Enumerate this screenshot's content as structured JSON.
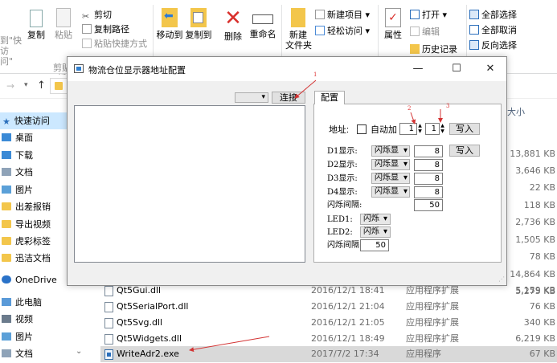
{
  "ribbon": {
    "clipboard_tail": [
      "到\"快",
      "访问\""
    ],
    "copy": "复制",
    "paste": "粘贴",
    "cut": "剪切",
    "copy_path": "复制路径",
    "paste_shortcut": "粘贴快捷方式",
    "group_clipboard": "剪贴板",
    "move_to": "移动到",
    "copy_to": "复制到",
    "delete": "删除",
    "rename": "重命名",
    "new_folder": "新建\n文件夹",
    "new_item": "新建项目",
    "easy_access": "轻松访问",
    "properties": "属性",
    "open": "打开",
    "edit": "编辑",
    "history": "历史记录",
    "select_all": "全部选择",
    "select_none": "全部取消",
    "invert_selection": "反向选择"
  },
  "size_header": "大小",
  "sidebar": {
    "items": [
      {
        "label": "快速访问",
        "icon": "star-icon"
      },
      {
        "label": "桌面",
        "icon": "desktop-folder-icon"
      },
      {
        "label": "下载",
        "icon": "download-folder-icon"
      },
      {
        "label": "文档",
        "icon": "documents-folder-icon"
      },
      {
        "label": "图片",
        "icon": "pictures-folder-icon"
      },
      {
        "label": "出差报销",
        "icon": "folder-icon"
      },
      {
        "label": "导出视频",
        "icon": "folder-icon"
      },
      {
        "label": "虎彩标签",
        "icon": "folder-icon"
      },
      {
        "label": "迅洁文档",
        "icon": "folder-icon"
      },
      {
        "label": "OneDrive",
        "icon": "cloud-icon"
      },
      {
        "label": "此电脑",
        "icon": "computer-icon"
      },
      {
        "label": "视频",
        "icon": "videos-folder-icon"
      },
      {
        "label": "图片",
        "icon": "pictures-folder-icon"
      },
      {
        "label": "文档",
        "icon": "documents-folder-icon"
      }
    ]
  },
  "hidden_sizes": [
    "13,881 KB",
    "3,646 KB",
    "22 KB",
    "118 KB",
    "2,736 KB",
    "1,505 KB",
    "78 KB",
    "14,864 KB",
    "5,275 KB"
  ],
  "files": [
    {
      "name": "Qt5Gui.dll",
      "date": "2016/12/1 18:41",
      "type": "应用程序扩展",
      "size": "5,159 KB"
    },
    {
      "name": "Qt5SerialPort.dll",
      "date": "2016/12/1 21:04",
      "type": "应用程序扩展",
      "size": "76 KB"
    },
    {
      "name": "Qt5Svg.dll",
      "date": "2016/12/1 21:05",
      "type": "应用程序扩展",
      "size": "340 KB"
    },
    {
      "name": "Qt5Widgets.dll",
      "date": "2016/12/1 18:49",
      "type": "应用程序扩展",
      "size": "6,219 KB"
    },
    {
      "name": "WriteAdr2.exe",
      "date": "2017/7/2 17:34",
      "type": "应用程序",
      "size": "67 KB"
    }
  ],
  "dialog": {
    "title": "物流仓位显示器地址配置",
    "connect": "连接",
    "tab": "配置",
    "address_label": "地址:",
    "auto_add": "自动加",
    "addr_a": "1",
    "addr_b": "1",
    "write": "写入",
    "d1_label": "D1显示:",
    "d2_label": "D2显示:",
    "d3_label": "D3显示:",
    "d4_label": "D4显示:",
    "mode": "闪烁显",
    "d1_val": "8",
    "d2_val": "8",
    "d3_val": "8",
    "d4_val": "8",
    "flash_interval_label": "闪烁间隔:",
    "flash_interval_val": "50",
    "led1_label": "LED1:",
    "led2_label": "LED2:",
    "led_mode": "闪烁",
    "flash_interval2_label": "闪烁间隔",
    "flash_interval2_val": "50"
  },
  "annotations": [
    "1",
    "2",
    "3"
  ],
  "colors": {
    "annotation": "#d33333",
    "selection": "#cce8ff",
    "folder": "#f3c64b"
  }
}
